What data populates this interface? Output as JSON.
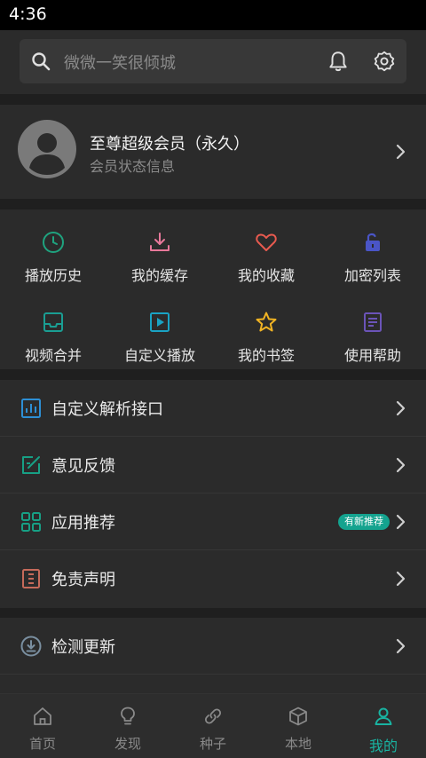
{
  "status_bar": {
    "time": "4:36"
  },
  "search": {
    "placeholder": "微微一笑很倾城"
  },
  "profile": {
    "title": "至尊超级会员（永久）",
    "subtitle": "会员状态信息"
  },
  "grid": [
    {
      "label": "播放历史",
      "icon": "clock-icon",
      "color": "#1fa37f"
    },
    {
      "label": "我的缓存",
      "icon": "download-icon",
      "color": "#e8789a"
    },
    {
      "label": "我的收藏",
      "icon": "heart-icon",
      "color": "#e85a4f"
    },
    {
      "label": "加密列表",
      "icon": "unlock-icon",
      "color": "#4a55c7"
    },
    {
      "label": "视频合并",
      "icon": "inbox-icon",
      "color": "#1a9e93"
    },
    {
      "label": "自定义播放",
      "icon": "play-square-icon",
      "color": "#1aa3c4"
    },
    {
      "label": "我的书签",
      "icon": "star-icon",
      "color": "#f0b323"
    },
    {
      "label": "使用帮助",
      "icon": "document-icon",
      "color": "#6b54b8"
    }
  ],
  "menu1": [
    {
      "label": "自定义解析接口",
      "icon": "chart-icon",
      "color": "#2d8fd5"
    },
    {
      "label": "意见反馈",
      "icon": "edit-icon",
      "color": "#17a085"
    },
    {
      "label": "应用推荐",
      "icon": "grid-icon",
      "color": "#17a085",
      "badge": "有新推荐"
    },
    {
      "label": "免责声明",
      "icon": "list-doc-icon",
      "color": "#c56a5a"
    }
  ],
  "menu2": [
    {
      "label": "检测更新",
      "icon": "download-circle-icon",
      "color": "#7a8fa0"
    }
  ],
  "nav": [
    {
      "label": "首页",
      "icon": "home-icon"
    },
    {
      "label": "发现",
      "icon": "bulb-icon"
    },
    {
      "label": "种子",
      "icon": "link-icon"
    },
    {
      "label": "本地",
      "icon": "cube-icon"
    },
    {
      "label": "我的",
      "icon": "person-icon",
      "active": true
    }
  ],
  "colors": {
    "accent": "#19b3a1",
    "background": "#1f1f1f",
    "card": "#2b2b2b"
  }
}
